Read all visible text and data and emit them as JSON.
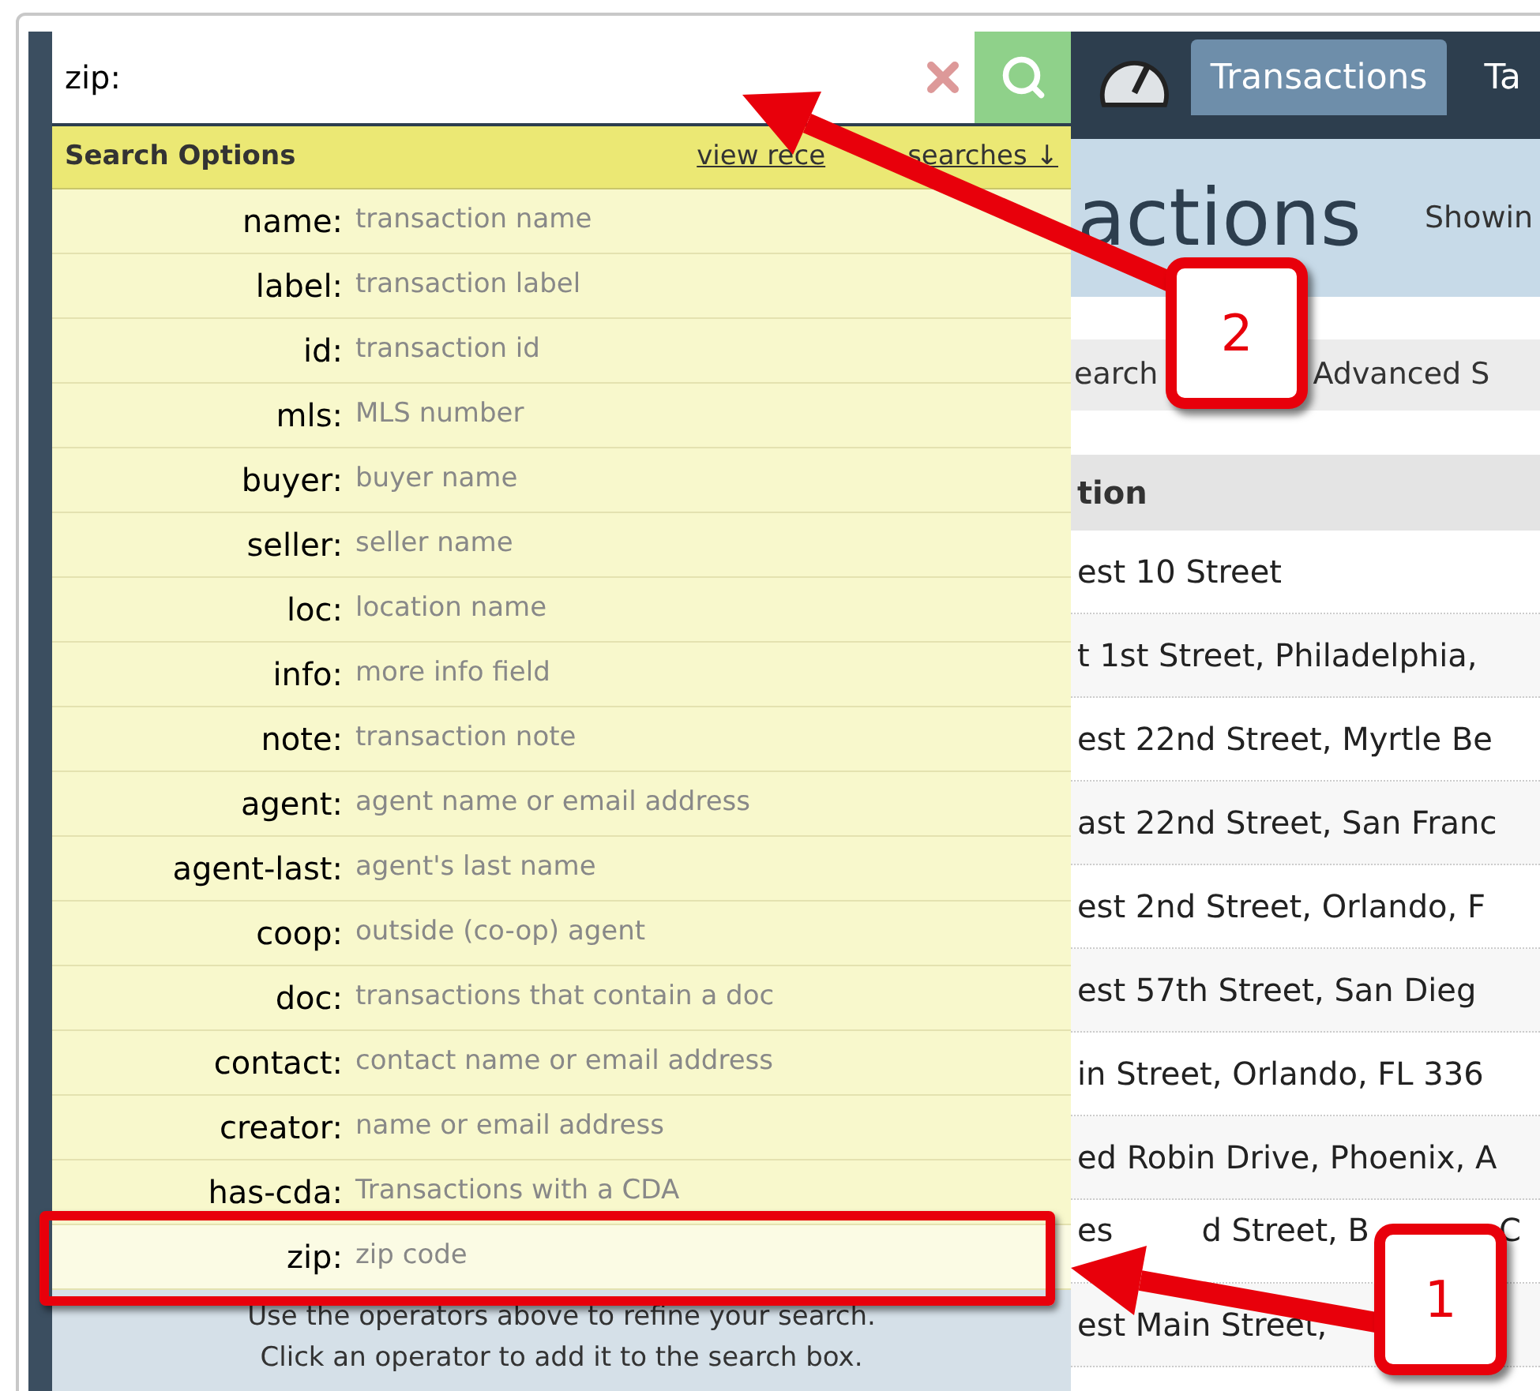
{
  "search": {
    "value": "zip:"
  },
  "nav": {
    "tabs": [
      {
        "label": "Transactions",
        "selected": true
      },
      {
        "label": "Ta",
        "selected": false
      }
    ]
  },
  "page_header": {
    "title": "actions",
    "subtitle": "Showin"
  },
  "subtabs": [
    "earch",
    "Advanced S"
  ],
  "table": {
    "column": "tion",
    "rows": [
      [
        "est 10 Street"
      ],
      [
        "t 1st Street, Philadelphia,"
      ],
      [
        "est 22nd Street, Myrtle Be"
      ],
      [
        "ast 22nd Street, San Franc"
      ],
      [
        "est 2nd Street, Orlando, F"
      ],
      [
        "est 57th Street, San Dieg"
      ],
      [
        "in Street, Orlando, FL 336"
      ],
      [
        "ed Robin Drive, Phoenix, A"
      ],
      [
        "es",
        "d Street, B",
        "C"
      ],
      [
        "est Main Street,"
      ]
    ]
  },
  "search_options": {
    "title": "Search Options",
    "recent_link": [
      "view rece",
      "searches ↓"
    ],
    "items": [
      {
        "operator": "name:",
        "hint": "transaction name",
        "selected": false
      },
      {
        "operator": "label:",
        "hint": "transaction label",
        "selected": false
      },
      {
        "operator": "id:",
        "hint": "transaction id",
        "selected": false
      },
      {
        "operator": "mls:",
        "hint": "MLS number",
        "selected": false
      },
      {
        "operator": "buyer:",
        "hint": "buyer name",
        "selected": false
      },
      {
        "operator": "seller:",
        "hint": "seller name",
        "selected": false
      },
      {
        "operator": "loc:",
        "hint": "location name",
        "selected": false
      },
      {
        "operator": "info:",
        "hint": "more info field",
        "selected": false
      },
      {
        "operator": "note:",
        "hint": "transaction note",
        "selected": false
      },
      {
        "operator": "agent:",
        "hint": "agent name or email address",
        "selected": false
      },
      {
        "operator": "agent-last:",
        "hint": "agent's last name",
        "selected": false
      },
      {
        "operator": "coop:",
        "hint": "outside (co-op) agent",
        "selected": false
      },
      {
        "operator": "doc:",
        "hint": "transactions that contain a doc",
        "selected": false
      },
      {
        "operator": "contact:",
        "hint": "contact name or email address",
        "selected": false
      },
      {
        "operator": "creator:",
        "hint": "name or email address",
        "selected": false
      },
      {
        "operator": "has-cda:",
        "hint": "Transactions with a CDA",
        "selected": false
      },
      {
        "operator": "zip:",
        "hint": "zip code",
        "selected": true
      }
    ],
    "footer": [
      "Use the operators above to refine your search.",
      "Click an operator to add it to the search box."
    ]
  },
  "callouts": [
    "2",
    "1"
  ]
}
